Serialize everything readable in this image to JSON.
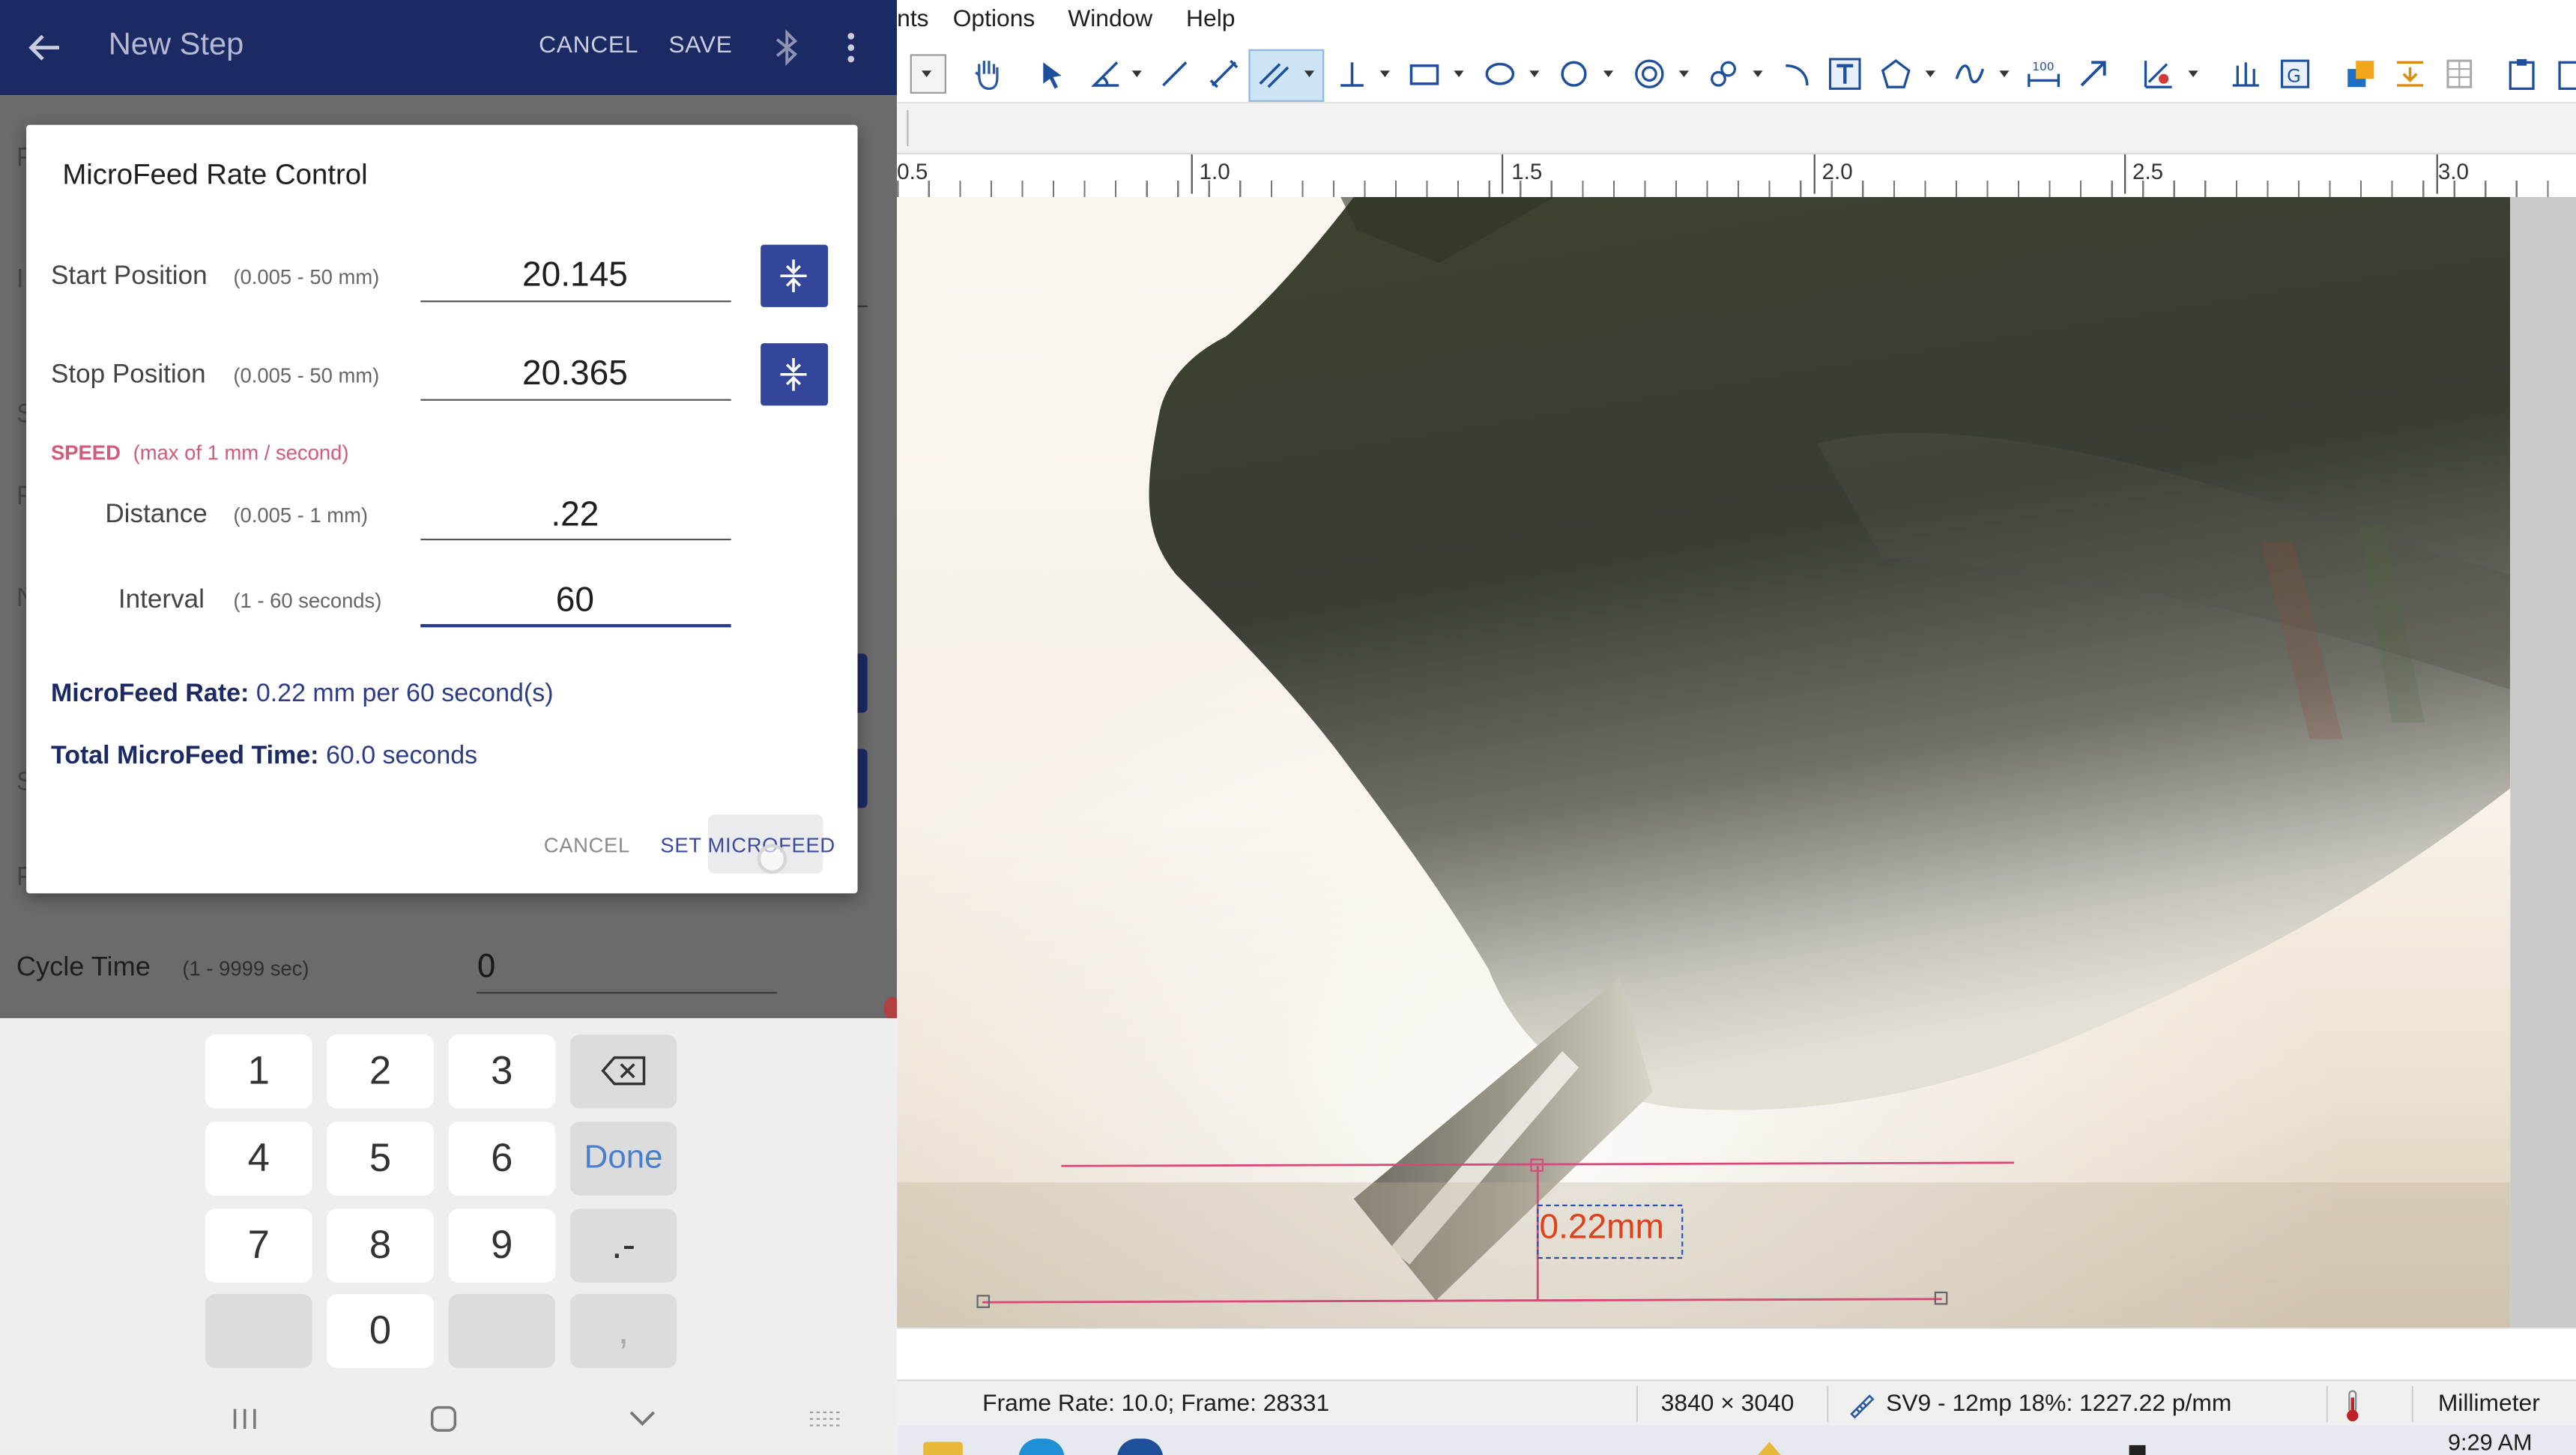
{
  "app_bar": {
    "title": "New Step",
    "cancel_label": "CANCEL",
    "save_label": "SAVE",
    "icons": [
      "back-arrow-icon",
      "bluetooth-icon",
      "more-vert-icon"
    ]
  },
  "background_form": {
    "cycle_time_label": "Cycle Time",
    "cycle_time_range": "(1 - 9999 sec)",
    "cycle_time_value": "0"
  },
  "dialog": {
    "title": "MicroFeed Rate Control",
    "start_position": {
      "label": "Start Position",
      "range": "(0.005 - 50 mm)",
      "value": "20.145"
    },
    "stop_position": {
      "label": "Stop Position",
      "range": "(0.005 - 50 mm)",
      "value": "20.365"
    },
    "speed": {
      "label": "SPEED",
      "note": "(max of 1 mm / second)"
    },
    "distance": {
      "label": "Distance",
      "range": "(0.005 - 1 mm)",
      "value": ".22"
    },
    "interval": {
      "label": "Interval",
      "range": "(1 - 60 seconds)",
      "value": "60"
    },
    "rate_label": "MicroFeed Rate:",
    "rate_value": "0.22 mm per 60 second(s)",
    "total_label": "Total MicroFeed Time:",
    "total_value": "60.0 seconds",
    "cancel_label": "CANCEL",
    "set_label": "SET MICROFEED"
  },
  "keypad": {
    "keys": [
      "1",
      "2",
      "3",
      "⌫",
      "4",
      "5",
      "6",
      "Done",
      "7",
      "8",
      "9",
      ".-",
      "",
      "0",
      "",
      ","
    ]
  },
  "desktop": {
    "menu": [
      "nts",
      "Options",
      "Window",
      "Help"
    ],
    "ruler_labels": [
      "0.5",
      "1.0",
      "1.5",
      "2.0",
      "2.5",
      "3.0"
    ],
    "measurement_label": "0.22mm",
    "status": {
      "frame": "Frame Rate: 10.0; Frame: 28331",
      "resolution": "3840 × 3040",
      "camera": "SV9 - 12mp 18%: 1227.22 p/mm",
      "unit": "Millimeter"
    },
    "clock": "9:29 AM"
  },
  "colors": {
    "app_bar": "#1c2a63",
    "accent_button": "#34469a",
    "speed_label": "#d25a7a",
    "measure_line": "#d8487a",
    "measure_text": "#e0401a",
    "toolbar_selected": "#cde4f7"
  }
}
